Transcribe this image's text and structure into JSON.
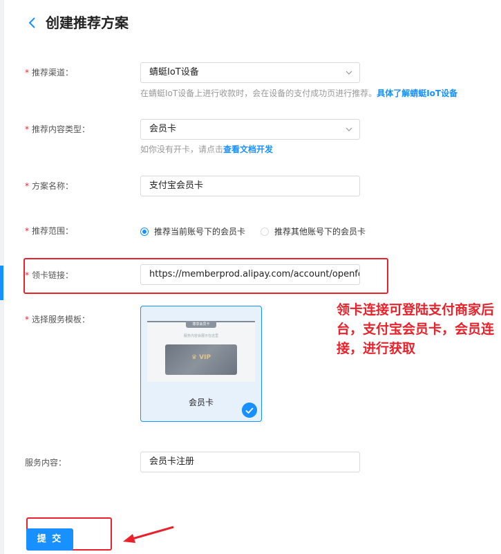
{
  "header": {
    "back_icon": "chevron-left-icon",
    "title": "创建推荐方案"
  },
  "form": {
    "channel": {
      "label": "推荐渠道：",
      "value": "蜻蜓IoT设备",
      "help": "在蜻蜓IoT设备上进行收款时，会在设备的支付成功页进行推荐。",
      "help_link": "具体了解蜻蜓IoT设备"
    },
    "content_type": {
      "label": "推荐内容类型：",
      "value": "会员卡",
      "help": "如你没有开卡，请点击",
      "help_link": "查看文档开发"
    },
    "plan_name": {
      "label": "方案名称：",
      "value": "支付宝会员卡"
    },
    "scope": {
      "label": "推荐范围：",
      "option1": "推荐当前账号下的会员卡",
      "option2": "推荐其他账号下的会员卡",
      "selected": 1
    },
    "card_link": {
      "label": "领卡链接：",
      "value": "https://memberprod.alipay.com/account/openform"
    },
    "template": {
      "label": "选择服务模板：",
      "card_name": "会员卡",
      "preview_tab": "尊享会员卡",
      "preview_hint": "服务内容会展示在这里",
      "preview_vip": "♛ VIP"
    },
    "service_content": {
      "label": "服务内容：",
      "value": "会员卡注册"
    },
    "submit_label": "提 交"
  },
  "annotation": {
    "text": "领卡连接可登陆支付商家后台，支付宝会员卡，会员连接，进行获取",
    "color": "#e8212a"
  },
  "colors": {
    "accent": "#1890ff",
    "required": "#f5222d"
  }
}
